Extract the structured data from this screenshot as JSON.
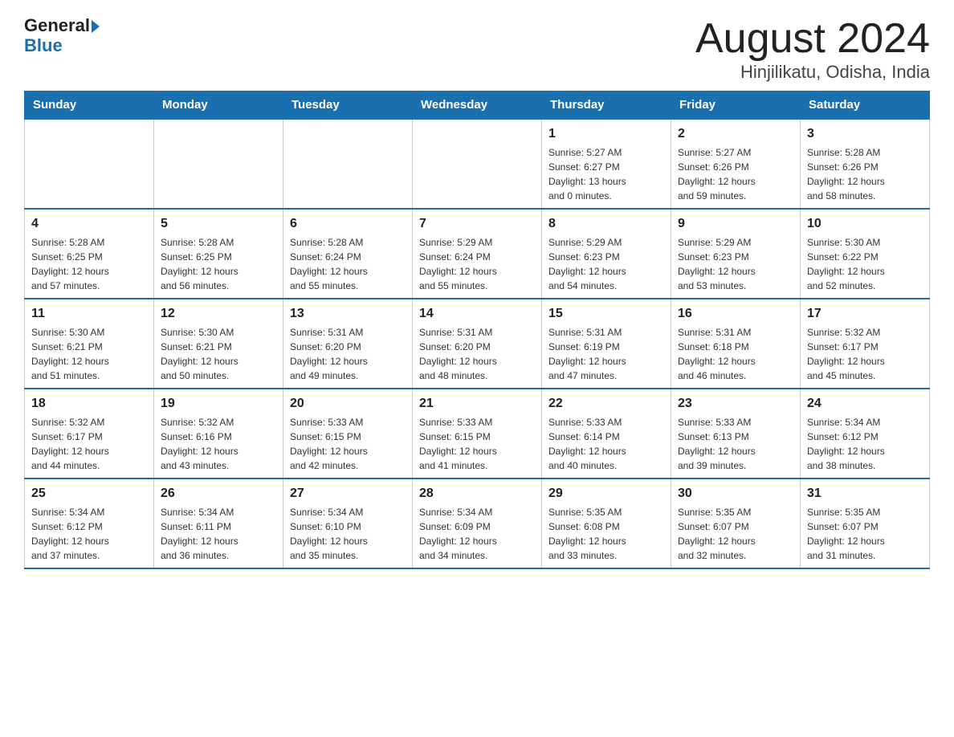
{
  "header": {
    "logo_general": "General",
    "logo_arrow": "▶",
    "logo_blue": "Blue",
    "month_title": "August 2024",
    "location": "Hinjilikatu, Odisha, India"
  },
  "days_of_week": [
    "Sunday",
    "Monday",
    "Tuesday",
    "Wednesday",
    "Thursday",
    "Friday",
    "Saturday"
  ],
  "weeks": [
    [
      {
        "day": "",
        "info": ""
      },
      {
        "day": "",
        "info": ""
      },
      {
        "day": "",
        "info": ""
      },
      {
        "day": "",
        "info": ""
      },
      {
        "day": "1",
        "info": "Sunrise: 5:27 AM\nSunset: 6:27 PM\nDaylight: 13 hours\nand 0 minutes."
      },
      {
        "day": "2",
        "info": "Sunrise: 5:27 AM\nSunset: 6:26 PM\nDaylight: 12 hours\nand 59 minutes."
      },
      {
        "day": "3",
        "info": "Sunrise: 5:28 AM\nSunset: 6:26 PM\nDaylight: 12 hours\nand 58 minutes."
      }
    ],
    [
      {
        "day": "4",
        "info": "Sunrise: 5:28 AM\nSunset: 6:25 PM\nDaylight: 12 hours\nand 57 minutes."
      },
      {
        "day": "5",
        "info": "Sunrise: 5:28 AM\nSunset: 6:25 PM\nDaylight: 12 hours\nand 56 minutes."
      },
      {
        "day": "6",
        "info": "Sunrise: 5:28 AM\nSunset: 6:24 PM\nDaylight: 12 hours\nand 55 minutes."
      },
      {
        "day": "7",
        "info": "Sunrise: 5:29 AM\nSunset: 6:24 PM\nDaylight: 12 hours\nand 55 minutes."
      },
      {
        "day": "8",
        "info": "Sunrise: 5:29 AM\nSunset: 6:23 PM\nDaylight: 12 hours\nand 54 minutes."
      },
      {
        "day": "9",
        "info": "Sunrise: 5:29 AM\nSunset: 6:23 PM\nDaylight: 12 hours\nand 53 minutes."
      },
      {
        "day": "10",
        "info": "Sunrise: 5:30 AM\nSunset: 6:22 PM\nDaylight: 12 hours\nand 52 minutes."
      }
    ],
    [
      {
        "day": "11",
        "info": "Sunrise: 5:30 AM\nSunset: 6:21 PM\nDaylight: 12 hours\nand 51 minutes."
      },
      {
        "day": "12",
        "info": "Sunrise: 5:30 AM\nSunset: 6:21 PM\nDaylight: 12 hours\nand 50 minutes."
      },
      {
        "day": "13",
        "info": "Sunrise: 5:31 AM\nSunset: 6:20 PM\nDaylight: 12 hours\nand 49 minutes."
      },
      {
        "day": "14",
        "info": "Sunrise: 5:31 AM\nSunset: 6:20 PM\nDaylight: 12 hours\nand 48 minutes."
      },
      {
        "day": "15",
        "info": "Sunrise: 5:31 AM\nSunset: 6:19 PM\nDaylight: 12 hours\nand 47 minutes."
      },
      {
        "day": "16",
        "info": "Sunrise: 5:31 AM\nSunset: 6:18 PM\nDaylight: 12 hours\nand 46 minutes."
      },
      {
        "day": "17",
        "info": "Sunrise: 5:32 AM\nSunset: 6:17 PM\nDaylight: 12 hours\nand 45 minutes."
      }
    ],
    [
      {
        "day": "18",
        "info": "Sunrise: 5:32 AM\nSunset: 6:17 PM\nDaylight: 12 hours\nand 44 minutes."
      },
      {
        "day": "19",
        "info": "Sunrise: 5:32 AM\nSunset: 6:16 PM\nDaylight: 12 hours\nand 43 minutes."
      },
      {
        "day": "20",
        "info": "Sunrise: 5:33 AM\nSunset: 6:15 PM\nDaylight: 12 hours\nand 42 minutes."
      },
      {
        "day": "21",
        "info": "Sunrise: 5:33 AM\nSunset: 6:15 PM\nDaylight: 12 hours\nand 41 minutes."
      },
      {
        "day": "22",
        "info": "Sunrise: 5:33 AM\nSunset: 6:14 PM\nDaylight: 12 hours\nand 40 minutes."
      },
      {
        "day": "23",
        "info": "Sunrise: 5:33 AM\nSunset: 6:13 PM\nDaylight: 12 hours\nand 39 minutes."
      },
      {
        "day": "24",
        "info": "Sunrise: 5:34 AM\nSunset: 6:12 PM\nDaylight: 12 hours\nand 38 minutes."
      }
    ],
    [
      {
        "day": "25",
        "info": "Sunrise: 5:34 AM\nSunset: 6:12 PM\nDaylight: 12 hours\nand 37 minutes."
      },
      {
        "day": "26",
        "info": "Sunrise: 5:34 AM\nSunset: 6:11 PM\nDaylight: 12 hours\nand 36 minutes."
      },
      {
        "day": "27",
        "info": "Sunrise: 5:34 AM\nSunset: 6:10 PM\nDaylight: 12 hours\nand 35 minutes."
      },
      {
        "day": "28",
        "info": "Sunrise: 5:34 AM\nSunset: 6:09 PM\nDaylight: 12 hours\nand 34 minutes."
      },
      {
        "day": "29",
        "info": "Sunrise: 5:35 AM\nSunset: 6:08 PM\nDaylight: 12 hours\nand 33 minutes."
      },
      {
        "day": "30",
        "info": "Sunrise: 5:35 AM\nSunset: 6:07 PM\nDaylight: 12 hours\nand 32 minutes."
      },
      {
        "day": "31",
        "info": "Sunrise: 5:35 AM\nSunset: 6:07 PM\nDaylight: 12 hours\nand 31 minutes."
      }
    ]
  ]
}
